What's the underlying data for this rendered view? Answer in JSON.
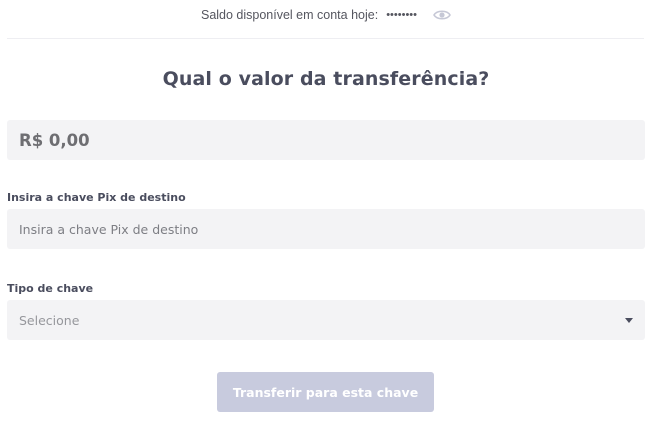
{
  "balance": {
    "label": "Saldo disponível em conta hoje:",
    "masked_value": "••••••••",
    "toggle_icon": "eye-icon"
  },
  "title": "Qual o valor da transferência?",
  "amount": {
    "value": "R$ 0,00"
  },
  "pix_key": {
    "label": "Insira a chave Pix de destino",
    "placeholder": "Insira a chave Pix de destino",
    "value": ""
  },
  "key_type": {
    "label": "Tipo de chave",
    "selected": "Selecione",
    "caret_icon": "caret-down-icon"
  },
  "submit": {
    "label": "Transferir para esta chave",
    "enabled": false
  },
  "colors": {
    "heading": "#4a4d5e",
    "field_background": "#f3f3f5",
    "button_disabled": "#c8cbde",
    "eye_icon": "#c6c8d6"
  }
}
